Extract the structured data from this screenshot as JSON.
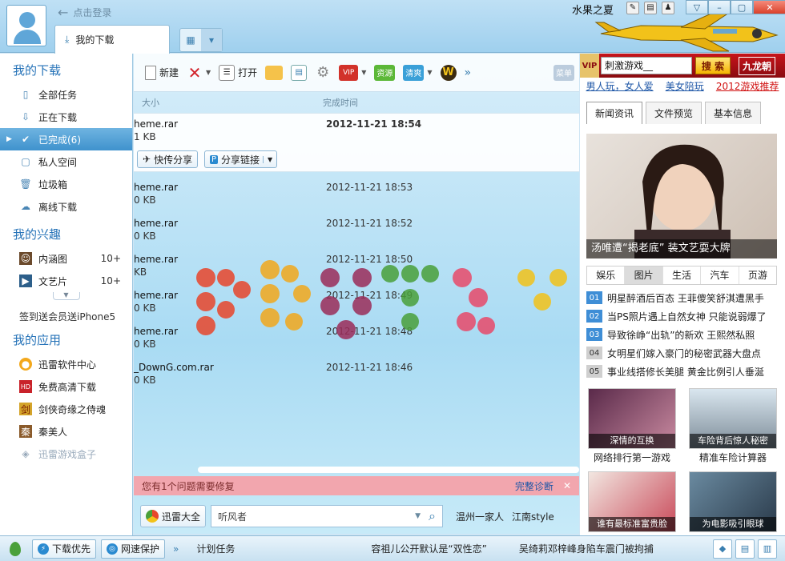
{
  "header": {
    "login_text": "点击登录",
    "tab_label": "我的下载",
    "skin_title": "水果之夏",
    "window_buttons": [
      "▽",
      "–",
      "▢",
      "✕"
    ]
  },
  "sidebar": {
    "sec_downloads": "我的下载",
    "items_download": [
      {
        "label": "全部任务"
      },
      {
        "label": "正在下载"
      },
      {
        "label": "已完成(6)"
      },
      {
        "label": "私人空间"
      },
      {
        "label": "垃圾箱"
      },
      {
        "label": "离线下载"
      }
    ],
    "sec_interest": "我的兴趣",
    "items_interest": [
      {
        "label": "内涵图",
        "count": "10+"
      },
      {
        "label": "文艺片",
        "count": "10+"
      }
    ],
    "sign_text": "签到送会员送iPhone5",
    "sec_apps": "我的应用",
    "items_apps": [
      {
        "label": "迅雷软件中心"
      },
      {
        "label": "免费高清下载"
      },
      {
        "label": "剑侠奇缘之侍魂"
      },
      {
        "label": "秦美人"
      },
      {
        "label": "迅雷游戏盒子"
      }
    ]
  },
  "toolbar": {
    "new_label": "新建",
    "open_label": "打开",
    "vip_label": "VIP",
    "res_label": "资源",
    "clear_label": "清爽",
    "menu_label": "菜单"
  },
  "columns": {
    "size": "大小",
    "time": "完成时间"
  },
  "files": [
    {
      "name": "heme.rar",
      "size": "1 KB",
      "date": "2012-11-21 18:54"
    },
    {
      "name": "heme.rar",
      "size": "0 KB",
      "date": "2012-11-21 18:53"
    },
    {
      "name": "heme.rar",
      "size": "0 KB",
      "date": "2012-11-21 18:52"
    },
    {
      "name": "heme.rar",
      "size": "KB",
      "date": "2012-11-21 18:50"
    },
    {
      "name": "heme.rar",
      "size": "0 KB",
      "date": "2012-11-21 18:49"
    },
    {
      "name": "heme.rar",
      "size": "0 KB",
      "date": "2012-11-21 18:48"
    },
    {
      "name": "_DownG.com.rar",
      "size": "0 KB",
      "date": "2012-11-21 18:46"
    }
  ],
  "share": {
    "quick": "快传分享",
    "link": "分享链接"
  },
  "notice": {
    "text": "您有1个问题需要修复",
    "fix": "完整诊断",
    "close": "✕"
  },
  "search": {
    "xunlei_all": "迅雷大全",
    "value": "听风者",
    "hot1": "温州一家人",
    "hot2": "江南style"
  },
  "right": {
    "vip": "VIP",
    "search_value": "刺激游戏__",
    "search_btn": "搜 索",
    "logo": "九龙朝",
    "links": [
      "男人玩，女人爱",
      "美女陪玩",
      "2012游戏推荐"
    ],
    "tabs": [
      "新闻资讯",
      "文件预览",
      "基本信息"
    ],
    "photo_caption": "汤唯遭“揭老底” 装文艺耍大牌",
    "cats": [
      "娱乐",
      "图片",
      "生活",
      "汽车",
      "页游"
    ],
    "news": [
      {
        "n": "01",
        "t": "明星醉酒后百态 王菲傻笑舒淇遭黑手"
      },
      {
        "n": "02",
        "t": "当PS照片遇上自然女神 只能说弱爆了"
      },
      {
        "n": "03",
        "t": "导致徐峥“出轨”的新欢 王熙然私照"
      },
      {
        "n": "04",
        "t": "女明星们嫁入豪门的秘密武器大盘点"
      },
      {
        "n": "05",
        "t": "事业线搭修长美腿 黄金比例引人垂涎"
      }
    ],
    "thumbs": [
      {
        "cap": "深情的互换",
        "label": "网络排行第一游戏"
      },
      {
        "cap": "车险背后惊人秘密",
        "label": "精准车险计算器"
      },
      {
        "cap": "谁有最标准富贵脸",
        "label": ""
      },
      {
        "cap": "为电影吸引眼球",
        "label": ""
      }
    ]
  },
  "status": {
    "priority": "下载优先",
    "protect": "网速保护",
    "plan": "计划任务",
    "news1": "容祖儿公开默认是“双性恋”",
    "news2": "吴绮莉邓梓峰身陷车震门被拘捕"
  },
  "colors": {
    "accent": "#2673b8",
    "active": "#3f92cd",
    "notice": "#f2a6ae",
    "brand_red": "#c7141a"
  }
}
